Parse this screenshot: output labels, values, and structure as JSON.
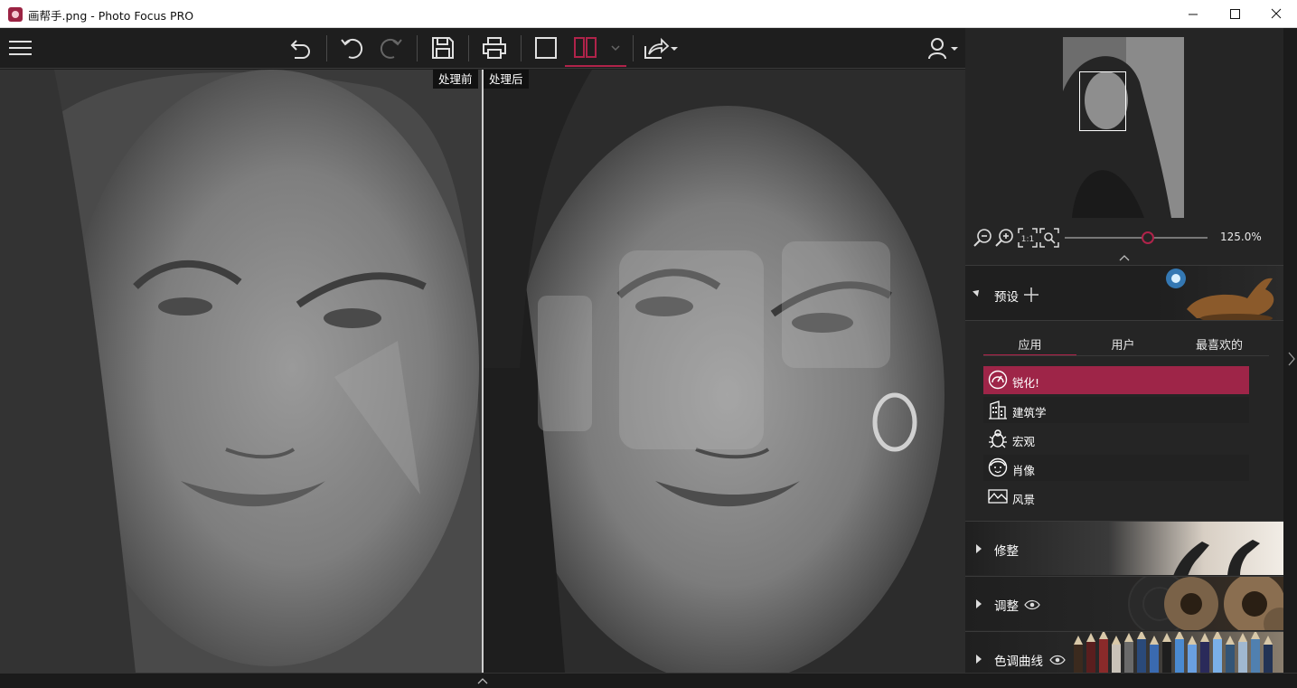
{
  "window": {
    "title": "画帮手.png - Photo Focus PRO",
    "minimize_label": "minimize",
    "maximize_label": "maximize",
    "close_label": "close"
  },
  "toolbar": {
    "menu_icon": "hamburger-icon",
    "undo_all_icon": "undo-all-icon",
    "undo_icon": "undo-icon",
    "redo_icon": "redo-icon",
    "save_icon": "save-icon",
    "print_icon": "print-icon",
    "single_view_icon": "single-view-icon",
    "split_view_icon": "split-view-icon",
    "share_icon": "share-icon",
    "user_icon": "user-icon"
  },
  "canvas": {
    "before_label": "处理前",
    "after_label": "处理后"
  },
  "navigator": {
    "zoom_value": "125.0%",
    "zoom_slider_fraction": 0.58
  },
  "presets": {
    "title": "预设",
    "tabs": [
      "应用",
      "用户",
      "最喜欢的"
    ],
    "active_tab": 0,
    "items": [
      {
        "label": "锐化!",
        "icon": "gauge-icon",
        "selected": true
      },
      {
        "label": "建筑学",
        "icon": "building-icon",
        "selected": false
      },
      {
        "label": "宏观",
        "icon": "bug-icon",
        "selected": false
      },
      {
        "label": "肖像",
        "icon": "face-icon",
        "selected": false
      },
      {
        "label": "风景",
        "icon": "mountain-icon",
        "selected": false
      }
    ]
  },
  "sections": [
    {
      "title": "修整",
      "has_eye": false
    },
    {
      "title": "调整",
      "has_eye": true
    },
    {
      "title": "色调曲线",
      "has_eye": true
    }
  ],
  "colors": {
    "accent": "#b0234a",
    "selected_item": "#9e2548",
    "panel_bg": "#252525"
  }
}
